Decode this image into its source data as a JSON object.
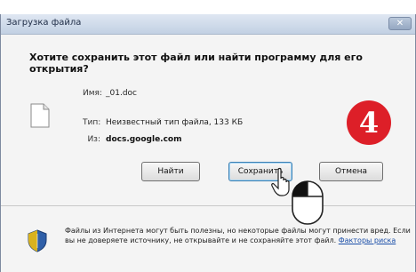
{
  "dialog": {
    "title": "Загрузка файла",
    "close_label": "✕",
    "question": "Хотите сохранить этот файл или найти программу для его открытия?",
    "file": {
      "name_label": "Имя:",
      "name_value": "_01.doc",
      "type_label": "Тип:",
      "type_value": "Неизвестный тип файла, 133 КБ",
      "from_label": "Из:",
      "from_value": "docs.google.com"
    },
    "buttons": {
      "find": "Найти",
      "save": "Сохранить",
      "cancel": "Отмена"
    },
    "warning": {
      "text": "Файлы из Интернета могут быть полезны, но некоторые файлы могут принести вред. Если вы не доверяете источнику, не открывайте и не сохраняйте этот файл.",
      "link": "Факторы риска"
    }
  },
  "step_badge": "4",
  "colors": {
    "badge": "#dd1f28",
    "titlebar": "#c2d0e3",
    "link": "#1a4ea8"
  },
  "icons": [
    "close-icon",
    "file-icon",
    "shield-icon",
    "cursor-icon",
    "mouse-icon"
  ]
}
